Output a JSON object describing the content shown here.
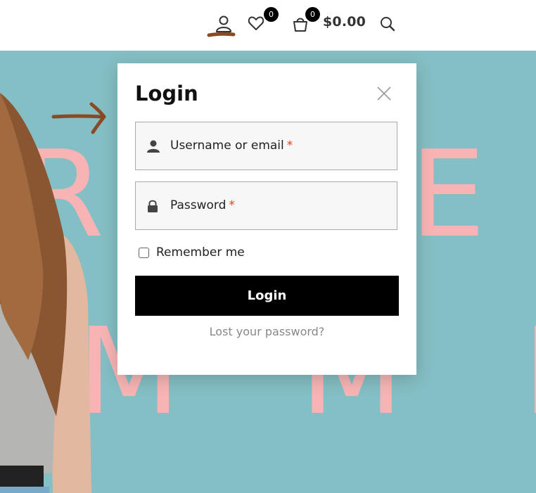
{
  "header": {
    "wishlist_count": "0",
    "cart_count": "0",
    "cart_total": "$0.00"
  },
  "hero": {
    "line1": "R L E",
    "line2": "M M E R"
  },
  "modal": {
    "title": "Login",
    "username_label": "Username or email",
    "password_label": "Password",
    "required_mark": "*",
    "remember_label": "Remember me",
    "submit_label": "Login",
    "lost_password_label": "Lost your password?"
  },
  "colors": {
    "hero_bg": "#84bfc5",
    "hero_text": "#f8b4b4",
    "accent_annotation": "#8b4a24",
    "button_bg": "#000000"
  }
}
